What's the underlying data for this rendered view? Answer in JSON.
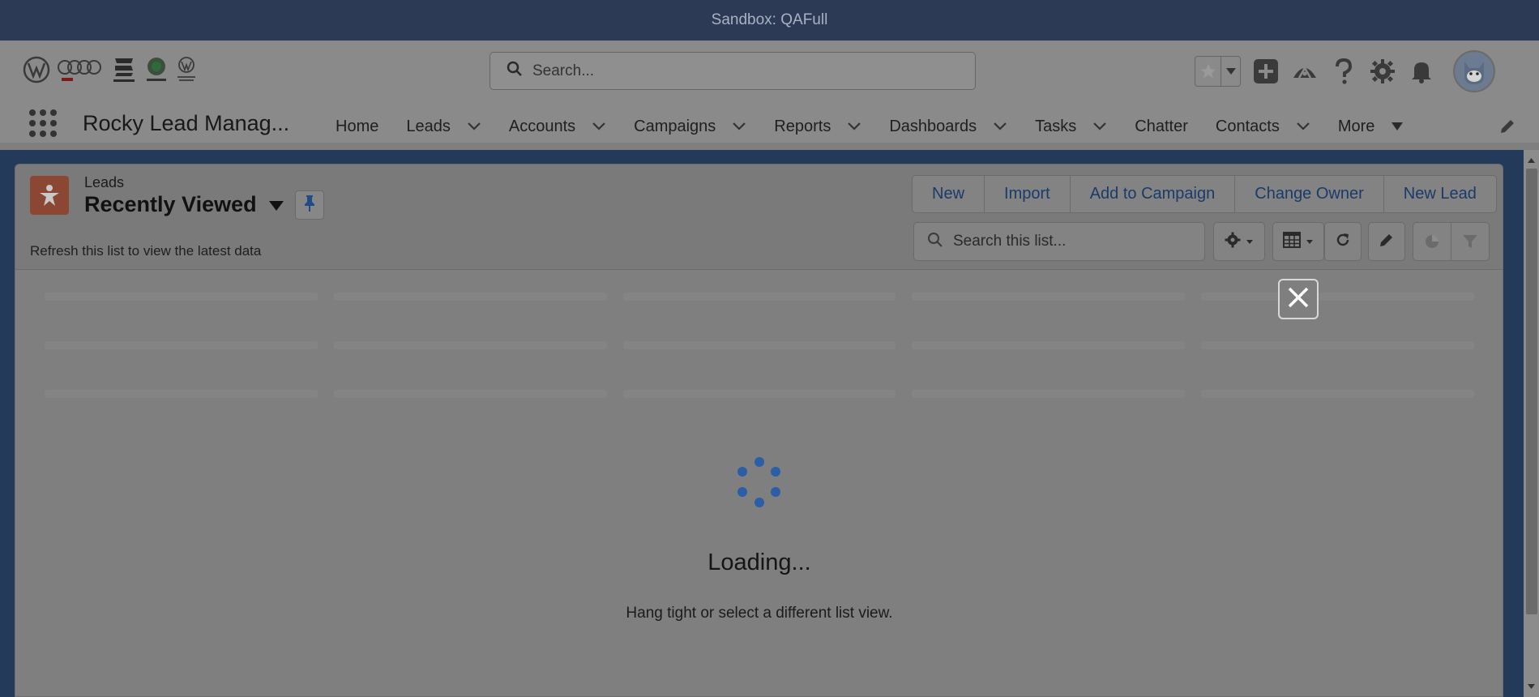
{
  "sandbox": {
    "label": "Sandbox: QAFull"
  },
  "header": {
    "brand_logos": [
      "VW",
      "Audi",
      "SEAT",
      "ŠKODA",
      "Volkswagen Nutzfahrzeuge"
    ],
    "search_placeholder": "Search...",
    "icons": [
      "favorite-star-icon",
      "favorites-dropdown-icon",
      "global-add-icon",
      "trailhead-icon",
      "help-icon",
      "setup-gear-icon",
      "notifications-bell-icon",
      "user-avatar"
    ]
  },
  "app_nav": {
    "app_name": "Rocky Lead Manag...",
    "items": [
      {
        "label": "Home",
        "has_menu": false
      },
      {
        "label": "Leads",
        "has_menu": true
      },
      {
        "label": "Accounts",
        "has_menu": true
      },
      {
        "label": "Campaigns",
        "has_menu": true
      },
      {
        "label": "Reports",
        "has_menu": true
      },
      {
        "label": "Dashboards",
        "has_menu": true
      },
      {
        "label": "Tasks",
        "has_menu": true
      },
      {
        "label": "Chatter",
        "has_menu": false
      },
      {
        "label": "Contacts",
        "has_menu": true
      },
      {
        "label": "More",
        "has_menu": true
      }
    ]
  },
  "list_view": {
    "object_label": "Leads",
    "title": "Recently Viewed",
    "refresh_message": "Refresh this list to view the latest data",
    "actions": [
      "New",
      "Import",
      "Add to Campaign",
      "Change Owner",
      "New Lead"
    ],
    "search_placeholder": "Search this list..."
  },
  "loading": {
    "title": "Loading...",
    "subtitle": "Hang tight or select a different list view."
  },
  "colors": {
    "overlay_gray": "#7f7f7f",
    "sandbox_bar": "#2d3a55",
    "spinner_blue": "#2b5ea7",
    "lead_icon": "#8b4733"
  }
}
